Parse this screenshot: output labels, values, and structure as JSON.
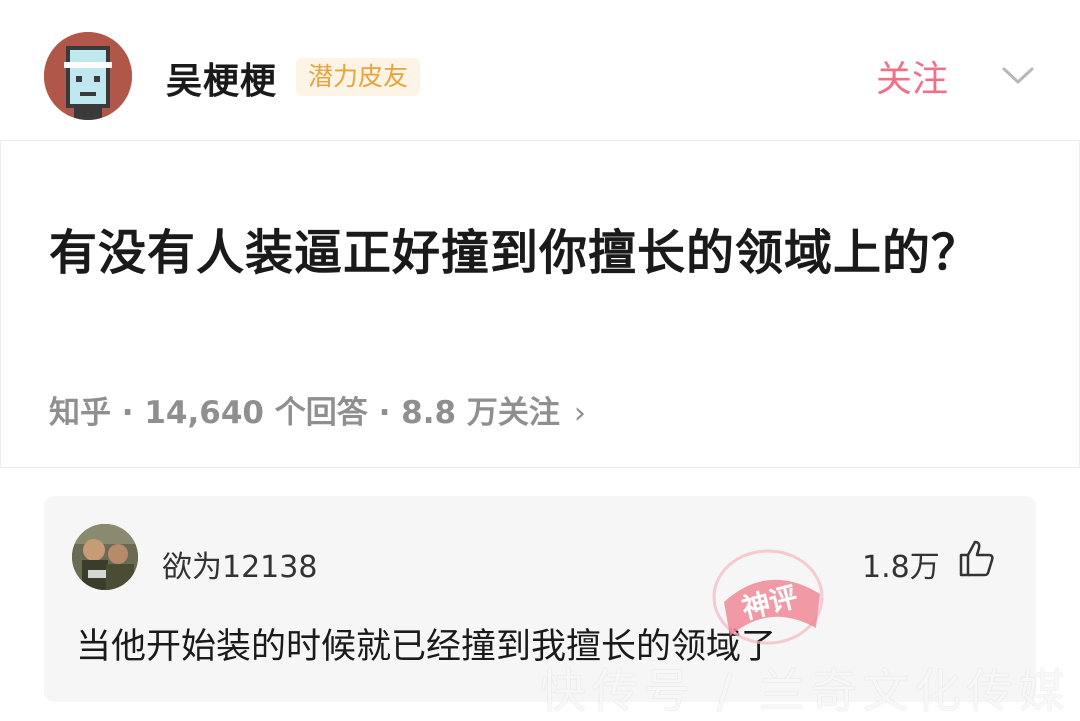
{
  "author": {
    "name": "吴梗梗",
    "badge": "潜力皮友",
    "follow_label": "关注",
    "avatar_icon": "pixel-character-avatar",
    "avatar_color": "#b0574a"
  },
  "question": {
    "title": "有没有人装逼正好撞到你擅长的领域上的？",
    "meta": "知乎 · 14,640 个回答 · 8.8 万关注",
    "meta_arrow": "›"
  },
  "answer": {
    "username": "欲为12138",
    "votes": "1.8万",
    "text": "当他开始装的时候就已经撞到我擅长的领域了",
    "avatar_icon": "photo-avatar"
  },
  "stamp": {
    "text": "神评",
    "color": "#f08a98"
  },
  "watermark": "快传号 / 兰奇文化传媒",
  "colors": {
    "accent": "#f0708a",
    "badge_text": "#e8a33d",
    "badge_bg": "#fdf4e6"
  }
}
